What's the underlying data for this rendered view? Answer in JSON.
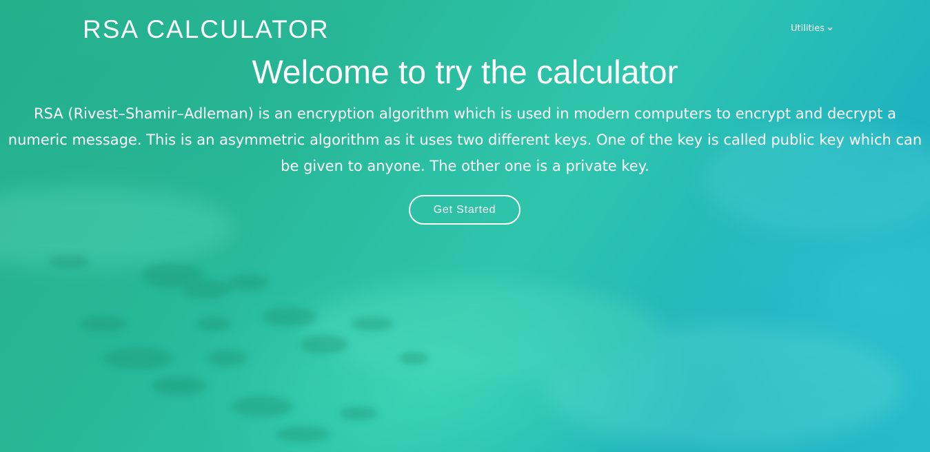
{
  "header": {
    "logo_text": "RSA CALCULATOR",
    "nav": {
      "utilities_label": "Utilities",
      "utilities_icon": "chevron-down-icon"
    }
  },
  "hero": {
    "title": "Welcome to try the calculator",
    "description": "RSA (Rivest–Shamir–Adleman) is an encryption algorithm which is used in modern computers to encrypt and decrypt a numeric message. This is an asymmetric algorithm as it uses two different keys. One of the key is called public key which can be given to anyone. The other one is a private key.",
    "cta_label": "Get Started"
  },
  "colors": {
    "background_start": "#25b08a",
    "background_end": "#28bccb",
    "text": "#ffffff"
  }
}
